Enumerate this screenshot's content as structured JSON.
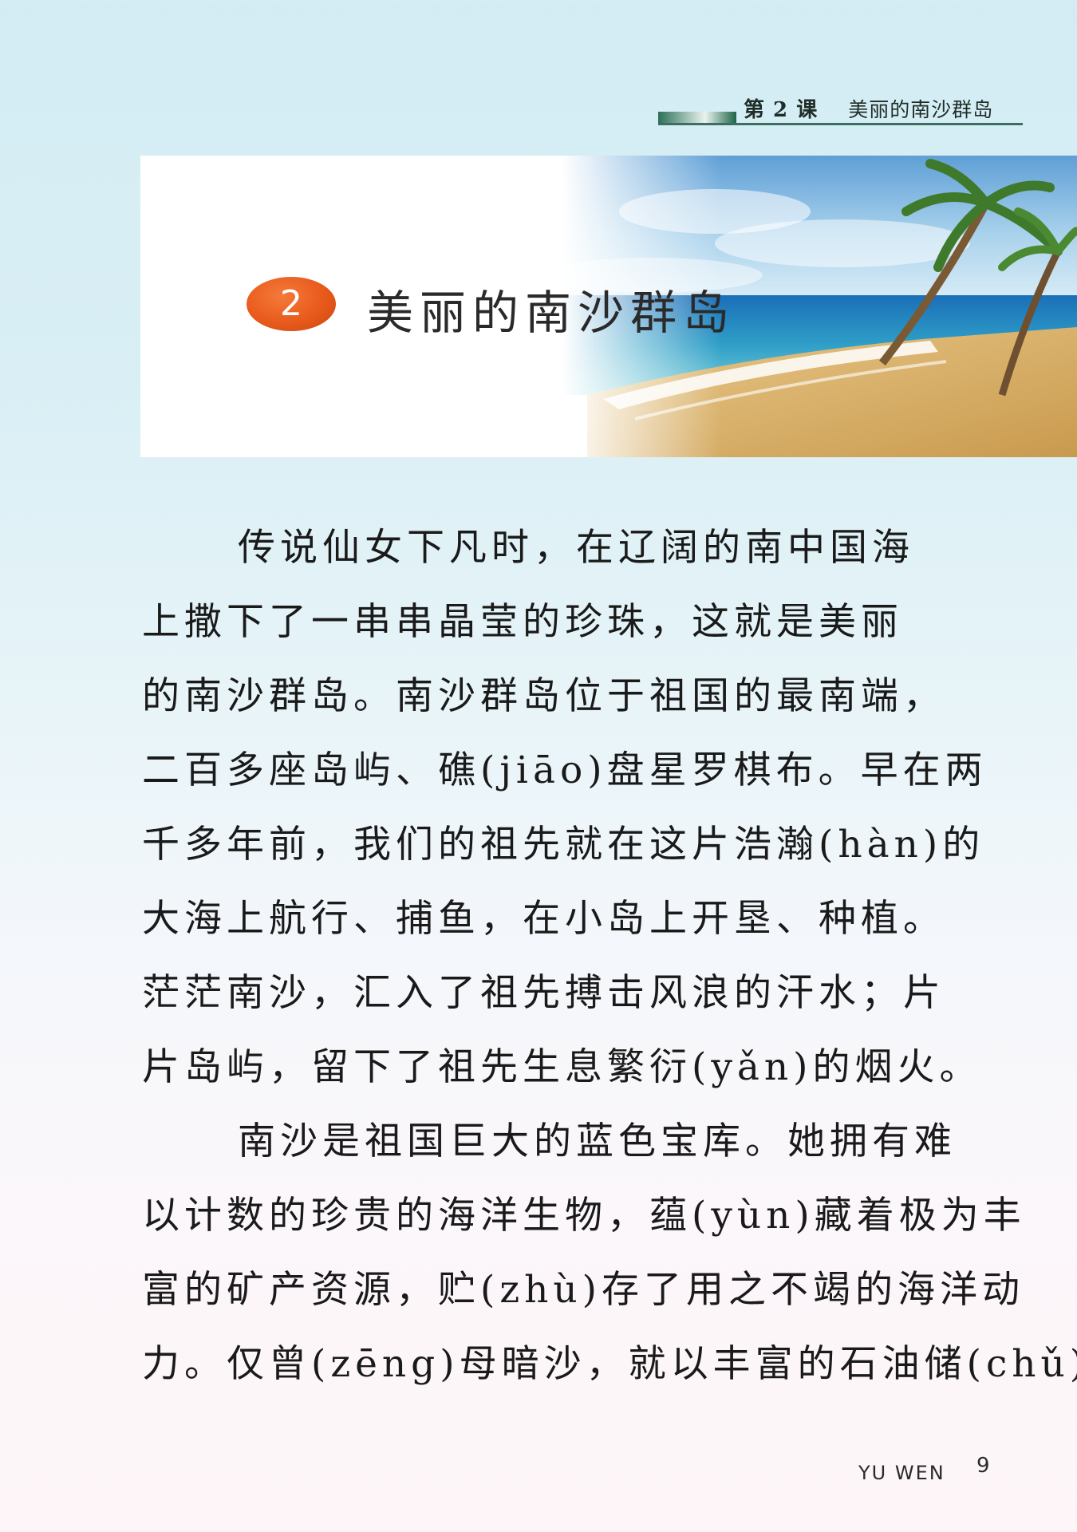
{
  "header": {
    "lesson": "第 2 课",
    "title": "美丽的南沙群岛"
  },
  "banner": {
    "number": "2",
    "title": "美丽的南沙群岛"
  },
  "body": {
    "lines": [
      "传说仙女下凡时，在辽阔的南中国海",
      "上撒下了一串串晶莹的珍珠，这就是美丽",
      "的南沙群岛。南沙群岛位于祖国的最南端，",
      "二百多座岛屿、礁(jiāo)盘星罗棋布。早在两",
      "千多年前，我们的祖先就在这片浩瀚(hàn)的",
      "大海上航行、捕鱼，在小岛上开垦、种植。",
      "茫茫南沙，汇入了祖先搏击风浪的汗水；片",
      "片岛屿，留下了祖先生息繁衍(yǎn)的烟火。",
      "南沙是祖国巨大的蓝色宝库。她拥有难",
      "以计数的珍贵的海洋生物，蕴(yùn)藏着极为丰",
      "富的矿产资源，贮(zhù)存了用之不竭的海洋动",
      "力。仅曾(zēng)母暗沙，就以丰富的石油储(chǔ)"
    ]
  },
  "footer": {
    "book": "YU WEN",
    "page": "9"
  }
}
